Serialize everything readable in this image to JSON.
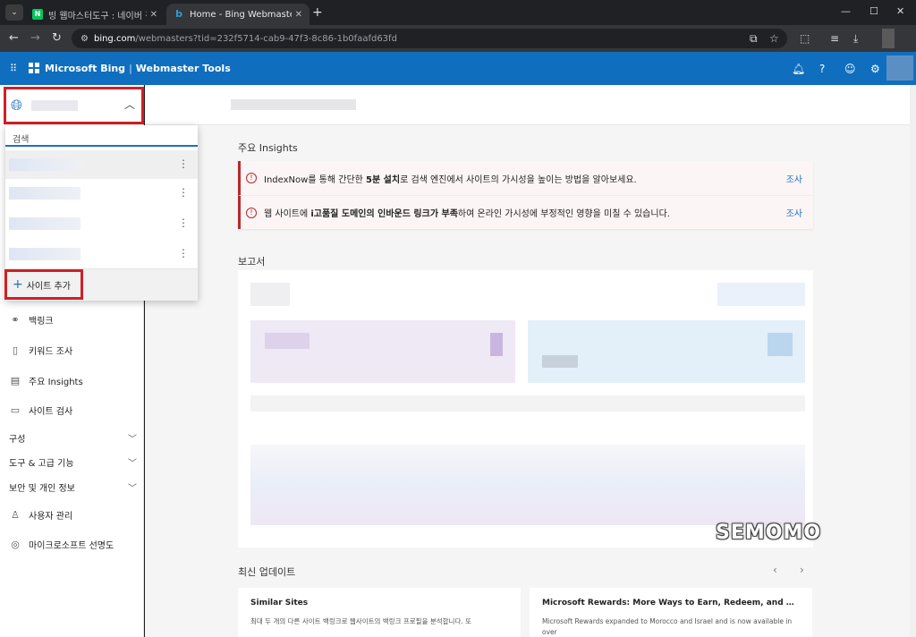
{
  "browser": {
    "tabs": [
      {
        "label": "빙 웹마스터도구 : 네이버 검색",
        "favicon": "N"
      },
      {
        "label": "Home - Bing Webmaster Tools",
        "favicon": "b"
      }
    ],
    "url_host": "bing.com",
    "url_rest": "/webmasters?tid=232f5714-cab9-47f3-8c86-1b0faafd63fd"
  },
  "header": {
    "brand": "Microsoft Bing",
    "product": "Webmaster Tools",
    "color": "#106ebe"
  },
  "dropdown": {
    "search_placeholder": "검색",
    "add_site_label": "사이트 추가"
  },
  "sidebar": {
    "items": [
      {
        "label": "백링크",
        "icon": "link-icon"
      },
      {
        "label": "키워드 조사",
        "icon": "document-icon"
      },
      {
        "label": "주요 Insights",
        "icon": "insights-icon"
      },
      {
        "label": "사이트 검사",
        "icon": "site-scan-icon"
      }
    ],
    "groups": [
      {
        "label": "구성"
      },
      {
        "label": "도구 & 고급 기능"
      },
      {
        "label": "보안 및 개인 정보"
      }
    ],
    "bottom_items": [
      {
        "label": "사용자 관리",
        "icon": "user-icon"
      },
      {
        "label": "마이크로소프트 선명도",
        "icon": "clarity-icon"
      }
    ]
  },
  "insights": {
    "title": "주요 Insights",
    "rows": [
      {
        "pre": "IndexNow를 통해 간단한 ",
        "bold": "5분 설치",
        "post": "로 검색 엔진에서 사이트의 가시성을 높이는 방법을 알아보세요.",
        "action": "조사"
      },
      {
        "pre": "웹 사이트에 ",
        "bold": "i고품질 도메인의 인바운드 링크가 부족",
        "post": "하여 온라인 가시성에 부정적인 영향을 미칠 수 있습니다.",
        "action": "조사"
      }
    ]
  },
  "reports": {
    "title": "보고서"
  },
  "updates": {
    "title": "최신 업데이트",
    "cards": [
      {
        "title": "Similar Sites",
        "desc": "최대 두 개의 다른 사이트 백링크로 웹사이트의 백링크 프로필을 분석합니다. 또"
      },
      {
        "title": "Microsoft Rewards: More Ways to Earn, Redeem, and Protect Your...",
        "desc": "Microsoft Rewards expanded to Morocco and Israel and is now available in over"
      }
    ]
  },
  "watermark": "SEMOMO"
}
